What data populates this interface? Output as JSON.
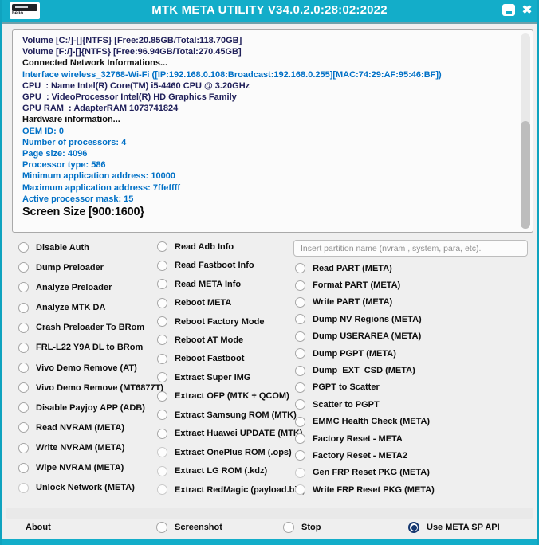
{
  "palette": {
    "titlebar_teal": "#13adc9",
    "border_teal": "#0fa3bf",
    "checked_navy": "#15376f",
    "log_navy_text": "#20205a",
    "log_blue_text": "#0070c6",
    "log_black_text": "#101010",
    "window_bg": "#efefef"
  },
  "window": {
    "title": "MTK META UTILITY V34.0.2.0:28:02:2022",
    "icon_label": "helio",
    "minimize_icon": "minimize-icon",
    "close_glyph": "✖"
  },
  "log": {
    "lines": [
      {
        "text": "Volume [C:/]-[]{NTFS} [Free:20.85GB/Total:118.70GB]",
        "color": "#20205a"
      },
      {
        "text": "Volume [F:/]-[]{NTFS} [Free:96.94GB/Total:270.45GB]",
        "color": "#20205a"
      },
      {
        "text": "Connected Network Informations...",
        "color": "#101010"
      },
      {
        "text": "Interface wireless_32768-Wi-Fi ([IP:192.168.0.108:Broadcast:192.168.0.255][MAC:74:29:AF:95:46:BF])",
        "color": "#0070c6"
      },
      {
        "text": "CPU  : Name Intel(R) Core(TM) i5-4460 CPU @ 3.20GHz",
        "color": "#20205a"
      },
      {
        "text": "GPU  : VideoProcessor Intel(R) HD Graphics Family",
        "color": "#20205a"
      },
      {
        "text": "GPU RAM  : AdapterRAM 1073741824",
        "color": "#20205a"
      },
      {
        "text": "Hardware information...",
        "color": "#101010"
      },
      {
        "text": "OEM ID: 0",
        "color": "#0070c6"
      },
      {
        "text": "Number of processors: 4",
        "color": "#0070c6"
      },
      {
        "text": "Page size: 4096",
        "color": "#0070c6"
      },
      {
        "text": "Processor type: 586",
        "color": "#0070c6"
      },
      {
        "text": "Minimum application address: 10000",
        "color": "#0070c6"
      },
      {
        "text": "Maximum application address: 7ffeffff",
        "color": "#0070c6"
      },
      {
        "text": "Active processor mask: 15",
        "color": "#0070c6"
      },
      {
        "text": "Screen Size [900:1600}",
        "color": "#0a0a0a",
        "large": true
      }
    ]
  },
  "partition_input": {
    "placeholder": "Insert partition name (nvram , system, para, etc)."
  },
  "columns": {
    "left": [
      {
        "label": "Disable Auth",
        "checked": false
      },
      {
        "label": "Dump Preloader",
        "checked": false
      },
      {
        "label": "Analyze Preloader",
        "checked": false
      },
      {
        "label": "Analyze MTK DA",
        "checked": false
      },
      {
        "label": "Crash Preloader To BRom",
        "checked": false
      },
      {
        "label": "FRL-L22 Y9A DL to BRom",
        "checked": false
      },
      {
        "label": "Vivo Demo Remove (AT)",
        "checked": false
      },
      {
        "label": "Vivo Demo Remove (MT6877T)",
        "checked": false
      },
      {
        "label": "Disable Payjoy APP (ADB)",
        "checked": false
      },
      {
        "label": "Read NVRAM (META)",
        "checked": false
      },
      {
        "label": "Write NVRAM (META)",
        "checked": false
      },
      {
        "label": "Wipe NVRAM (META)",
        "checked": false
      },
      {
        "label": "Unlock Network (META)",
        "checked": false,
        "dim": true
      }
    ],
    "middle": [
      {
        "label": "Read Adb Info",
        "checked": false
      },
      {
        "label": "Read Fastboot Info",
        "checked": false
      },
      {
        "label": "Read META Info",
        "checked": false
      },
      {
        "label": "Reboot META",
        "checked": false
      },
      {
        "label": "Reboot Factory Mode",
        "checked": false
      },
      {
        "label": "Reboot AT Mode",
        "checked": false
      },
      {
        "label": "Reboot Fastboot",
        "checked": false
      },
      {
        "label": "Extract Super IMG",
        "checked": false
      },
      {
        "label": "Extract OFP (MTK + QCOM)",
        "checked": false
      },
      {
        "label": "Extract Samsung ROM (MTK)",
        "checked": false
      },
      {
        "label": "Extract Huawei UPDATE (MTK)",
        "checked": false
      },
      {
        "label": "Extract OnePlus ROM (.ops)",
        "checked": false,
        "dim": true
      },
      {
        "label": "Extract LG ROM (.kdz)",
        "checked": false,
        "dim": true
      },
      {
        "label": "Extract RedMagic (payload.bin)",
        "checked": false,
        "dim": true
      }
    ],
    "right": [
      {
        "label": "Read PART (META)",
        "checked": false
      },
      {
        "label": "Format PART (META)",
        "checked": false
      },
      {
        "label": "Write PART (META)",
        "checked": false
      },
      {
        "label": "Dump NV Regions (META)",
        "checked": false
      },
      {
        "label": "Dump USERAREA (META)",
        "checked": false
      },
      {
        "label": "Dump PGPT (META)",
        "checked": false
      },
      {
        "label": "Dump  EXT_CSD (META)",
        "checked": false
      },
      {
        "label": "PGPT to Scatter",
        "checked": false
      },
      {
        "label": "Scatter to PGPT",
        "checked": false
      },
      {
        "label": "EMMC Health Check (META)",
        "checked": false
      },
      {
        "label": "Factory Reset - META",
        "checked": false
      },
      {
        "label": "Factory Reset - META2",
        "checked": false
      },
      {
        "label": "Gen FRP Reset PKG (META)",
        "checked": false,
        "dim": true
      },
      {
        "label": "Write FRP Reset PKG (META)",
        "checked": false,
        "dim": true
      }
    ]
  },
  "bottom_bar": {
    "about_label": "About",
    "options": [
      {
        "label": "Screenshot",
        "checked": false
      },
      {
        "label": "Stop",
        "checked": false
      },
      {
        "label": "Use META SP API",
        "checked": true
      }
    ]
  }
}
